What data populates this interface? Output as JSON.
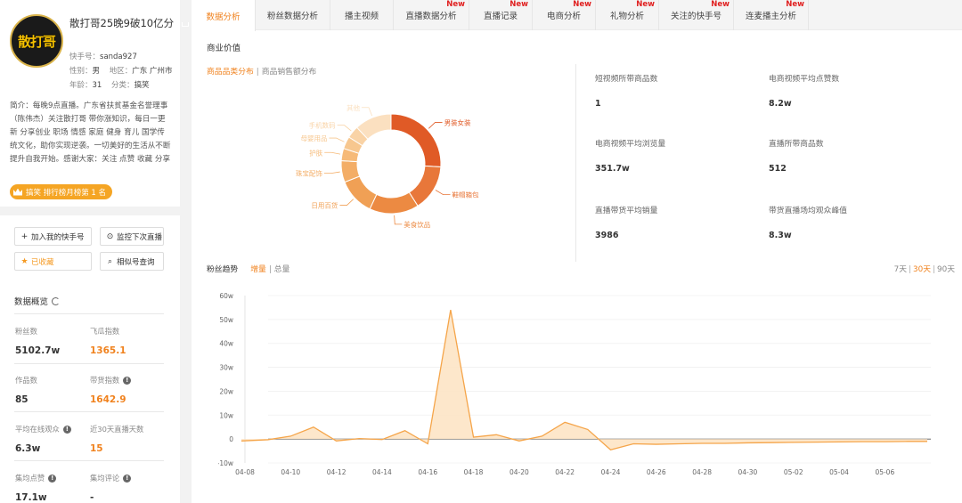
{
  "profile": {
    "avatar_text": "散打哥",
    "name": "散打哥25晚9破10亿分",
    "kuaishou_id_label": "快手号：",
    "kuaishou_id": "sanda927",
    "gender_label": "性别：",
    "gender": "男",
    "region_label": "地区：",
    "region": "广东 广州市",
    "age_label": "年龄：",
    "age": "31",
    "category_label": "分类：",
    "category": "搞笑",
    "bio": "简介：每晚9点直播。广东省扶贫基金名誉理事（陈伟杰）关注散打哥 带你涨知识，每日一更新 分享创业 职场 情感 家庭 健身 育儿 国学传统文化，助你实现逆袭。一切美好的生活从不断提升自我开始。感谢大家：关注 点赞 收藏 分享",
    "rank_badge": "搞笑 排行榜月榜第 1 名"
  },
  "actions": {
    "add_my_kuaishou": "加入我的快手号",
    "monitor_live": "监控下次直播",
    "collected": "已收藏",
    "similar_search": "相似号查询"
  },
  "overview": {
    "title": "数据概览",
    "stats": [
      {
        "label": "粉丝数",
        "value": "5102.7w",
        "highlight": false,
        "info": false
      },
      {
        "label": "飞瓜指数",
        "value": "1365.1",
        "highlight": true,
        "info": false
      },
      {
        "label": "作品数",
        "value": "85",
        "highlight": false,
        "info": false
      },
      {
        "label": "带货指数",
        "value": "1642.9",
        "highlight": true,
        "info": true
      },
      {
        "label": "平均在线观众",
        "value": "6.3w",
        "highlight": false,
        "info": true
      },
      {
        "label": "近30天直播天数",
        "value": "15",
        "highlight": true,
        "info": false
      },
      {
        "label": "集均点赞",
        "value": "17.1w",
        "highlight": false,
        "info": true
      },
      {
        "label": "集均评论",
        "value": "-",
        "highlight": false,
        "info": true
      }
    ]
  },
  "tabs": [
    {
      "label": "数据分析",
      "active": true,
      "new": false
    },
    {
      "label": "粉丝数据分析",
      "active": false,
      "new": false
    },
    {
      "label": "播主视频",
      "active": false,
      "new": false
    },
    {
      "label": "直播数据分析",
      "active": false,
      "new": true
    },
    {
      "label": "直播记录",
      "active": false,
      "new": true
    },
    {
      "label": "电商分析",
      "active": false,
      "new": true
    },
    {
      "label": "礼物分析",
      "active": false,
      "new": true
    },
    {
      "label": "关注的快手号",
      "active": false,
      "new": true
    },
    {
      "label": "连麦播主分析",
      "active": false,
      "new": true
    }
  ],
  "new_badge": "New",
  "business": {
    "title": "商业价值",
    "subtab_active": "商品品类分布",
    "subtab_sep": "|",
    "subtab_other": "商品销售额分布"
  },
  "kpis": [
    {
      "label": "短视频所带商品数",
      "value": "1"
    },
    {
      "label": "电商视频平均点赞数",
      "value": "8.2w"
    },
    {
      "label": "电商视频平均浏览量",
      "value": "351.7w"
    },
    {
      "label": "直播所带商品数",
      "value": "512"
    },
    {
      "label": "直播带货平均销量",
      "value": "3986"
    },
    {
      "label": "带货直播场均观众峰值",
      "value": "8.3w"
    }
  ],
  "fans": {
    "title": "粉丝趋势",
    "subtab_active": "增量",
    "subtab_sep": "|",
    "subtab_other": "总量",
    "range_7": "7天",
    "range_30": "30天",
    "range_90": "90天",
    "range_sep": "|"
  },
  "colors": {
    "accent": "#f0821e",
    "line": "#f5a54a",
    "area": "#fde3c2"
  },
  "chart_data": [
    {
      "type": "pie",
      "title": "",
      "categories": [
        "男装女装",
        "鞋帽箱包",
        "美食饮品",
        "日用百货",
        "珠宝配饰",
        "护肤",
        "母婴用品",
        "手机数码",
        "其他"
      ],
      "values": [
        26,
        15,
        16,
        12,
        7,
        4,
        4,
        4,
        12
      ],
      "colors": [
        "#e05a26",
        "#e8773a",
        "#ec8a42",
        "#f0a055",
        "#f3ad66",
        "#f6ba78",
        "#f7c78f",
        "#f9d3a6",
        "#fbe0c0"
      ]
    },
    {
      "type": "area",
      "title": "",
      "x": [
        "04-08",
        "04-09",
        "04-10",
        "04-11",
        "04-12",
        "04-13",
        "04-14",
        "04-15",
        "04-16",
        "04-17",
        "04-18",
        "04-19",
        "04-20",
        "04-21",
        "04-22",
        "04-23",
        "04-24",
        "04-25",
        "04-26",
        "04-27",
        "04-28",
        "04-29",
        "04-30",
        "05-01",
        "05-02",
        "05-03",
        "05-04",
        "05-05",
        "05-06",
        "05-07"
      ],
      "tick_labels": [
        "04-08",
        "04-10",
        "04-12",
        "04-14",
        "04-16",
        "04-18",
        "04-20",
        "04-22",
        "04-24",
        "04-26",
        "04-28",
        "04-30",
        "05-02",
        "05-04",
        "05-06"
      ],
      "y_ticks": [
        "-10w",
        "0",
        "10w",
        "20w",
        "30w",
        "40w",
        "50w",
        "60w"
      ],
      "series": [
        {
          "values": [
            -0.8,
            -0.3,
            1.2,
            5.0,
            -0.8,
            0.2,
            -0.2,
            3.5,
            -2.0,
            54.0,
            0.8,
            1.8,
            -0.8,
            1.2,
            7.0,
            4.0,
            -4.5,
            -2.0,
            -2.2,
            -2.0,
            -1.8,
            -1.8,
            -1.6,
            -1.5,
            -1.4,
            -1.3,
            -1.2,
            -1.1,
            -1.1,
            -1.0
          ]
        }
      ],
      "ylim": [
        -10,
        60
      ],
      "grid": true
    }
  ]
}
